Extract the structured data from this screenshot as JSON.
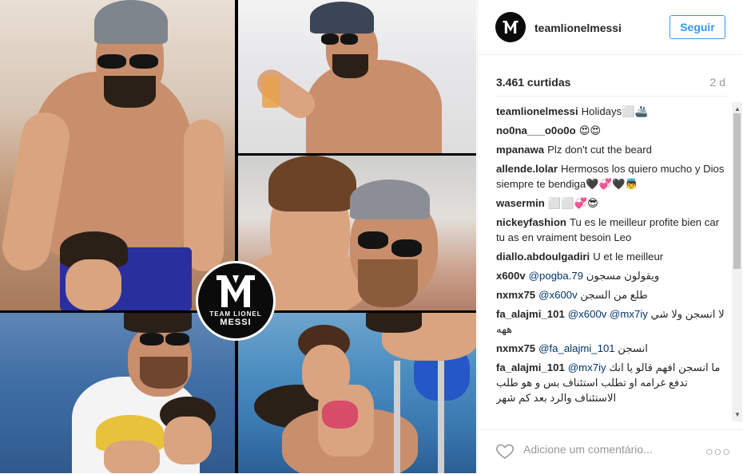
{
  "post": {
    "username": "teamlionelmessi",
    "follow_label": "Seguir",
    "likes": "3.461 curtidas",
    "age": "2 d",
    "logo_text_top": "TEAM LIONEL",
    "logo_text_bottom": "MESSI",
    "comments": [
      {
        "user": "teamlionelmessi",
        "text": "Holidays⬜🚢"
      },
      {
        "user": "no0na___o0o0o",
        "text": "😍😍"
      },
      {
        "user": "mpanawa",
        "text": "Plz don't cut the beard"
      },
      {
        "user": "allende.lolar",
        "text": "Hermosos los quiero mucho y Dios siempre te bendiga🖤💞🖤👼"
      },
      {
        "user": "wasermin",
        "text": "⬜⬜💞😎"
      },
      {
        "user": "nickeyfashion",
        "text": "Tu es le meilleur profite bien car tu as en vraiment besoin Leo"
      },
      {
        "user": "diallo.abdoulgadiri",
        "text": "U et le meilleur"
      },
      {
        "user": "x600v",
        "mention": "@pogba.79",
        "text": "ويقولون مسجون"
      },
      {
        "user": "nxmx75",
        "mention": "@x600v",
        "text": "طلع من السجن"
      },
      {
        "user": "fa_alajmi_101",
        "mention": "@x600v @mx7iy",
        "text": "لا انسجن ولا شي ههه"
      },
      {
        "user": "nxmx75",
        "mention": "@fa_alajmi_101",
        "text": "انسجن"
      },
      {
        "user": "fa_alajmi_101",
        "mention": "@mx7iy",
        "text": "ما انسجن افهم قالو يا انك تدفع غرامه او تطلب استئناف بس و هو طلب الاستئناف والرد بعد كم شهر"
      }
    ],
    "add_comment_placeholder": "Adicione um comentário...",
    "more_label": "○○○"
  },
  "colors": {
    "accent": "#3897f0",
    "text": "#262626",
    "muted": "#999999"
  }
}
